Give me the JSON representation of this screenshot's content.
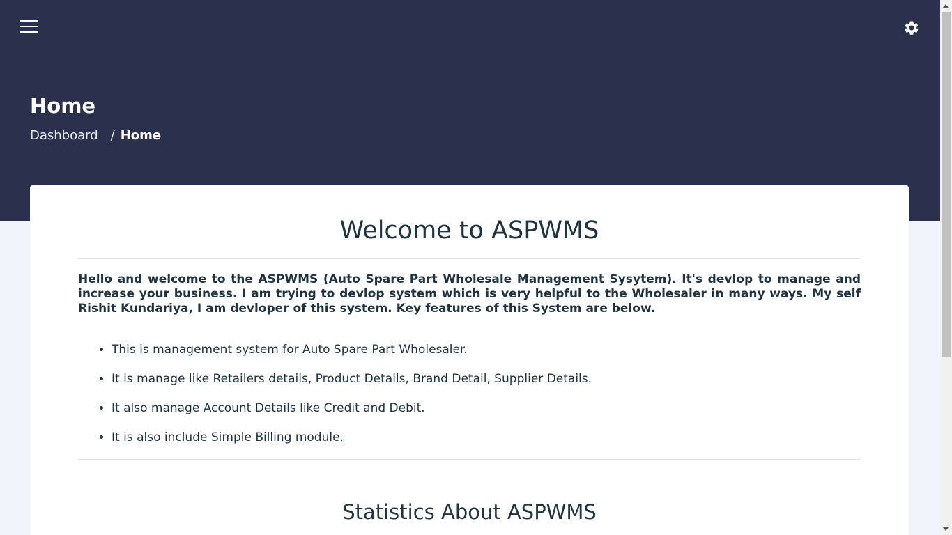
{
  "header": {
    "page_title": "Home",
    "breadcrumb": {
      "parent": "Dashboard",
      "separator": "/",
      "current": "Home"
    },
    "menu_icon": "hamburger-menu-icon",
    "settings_icon": "gear-icon"
  },
  "main": {
    "welcome_title": "Welcome to ASPWMS",
    "intro": "Hello and welcome to the ASPWMS (Auto Spare Part Wholesale Management Sysytem). It's devlop to manage and increase your business. I am trying to devlop system which is very helpful to the Wholesaler in many ways. My self Rishit Kundariya, I am devloper of this system. Key features of this System are below.",
    "features": [
      "This is management system for Auto Spare Part Wholesaler.",
      "It is manage like Retailers details, Product Details, Brand Detail, Supplier Details.",
      "It also manage Account Details like Credit and Debit.",
      "It is also include Simple Billing module."
    ],
    "stats_title": "Statistics About ASPWMS"
  },
  "colors": {
    "header_background": "#2b304d",
    "page_background": "#f2f4fb",
    "card_background": "#ffffff",
    "text_dark": "#1f3440"
  }
}
